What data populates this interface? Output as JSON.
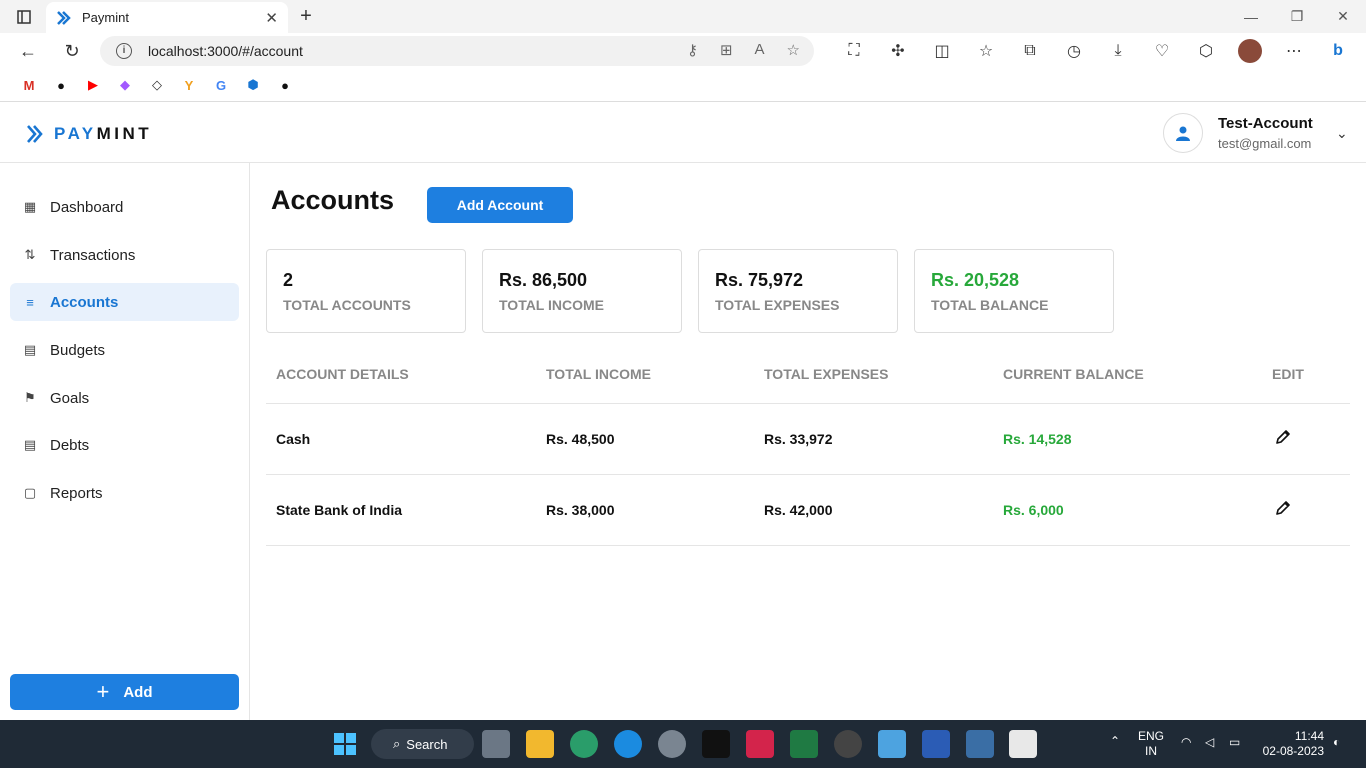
{
  "browser": {
    "tab_title": "Paymint",
    "url": "localhost:3000/#/account"
  },
  "app": {
    "logo_pay": "PAY",
    "logo_mint": "MINT",
    "user": {
      "name": "Test-Account",
      "email": "test@gmail.com"
    }
  },
  "sidebar": {
    "items": [
      {
        "label": "Dashboard",
        "icon": "grid-icon"
      },
      {
        "label": "Transactions",
        "icon": "transactions-icon"
      },
      {
        "label": "Accounts",
        "icon": "database-icon"
      },
      {
        "label": "Budgets",
        "icon": "calendar-icon"
      },
      {
        "label": "Goals",
        "icon": "goal-icon"
      },
      {
        "label": "Debts",
        "icon": "calendar-icon"
      },
      {
        "label": "Reports",
        "icon": "clipboard-icon"
      }
    ],
    "active": "Accounts",
    "add_label": "Add"
  },
  "page": {
    "title": "Accounts",
    "add_account_label": "Add Account"
  },
  "summary": [
    {
      "value": "2",
      "label": "TOTAL ACCOUNTS"
    },
    {
      "value": "Rs. 86,500",
      "label": "TOTAL INCOME"
    },
    {
      "value": "Rs. 75,972",
      "label": "TOTAL EXPENSES"
    },
    {
      "value": "Rs. 20,528",
      "label": "TOTAL BALANCE"
    }
  ],
  "table": {
    "headers": [
      "ACCOUNT DETAILS",
      "TOTAL INCOME",
      "TOTAL EXPENSES",
      "CURRENT BALANCE",
      "EDIT"
    ],
    "rows": [
      {
        "name": "Cash",
        "income": "Rs. 48,500",
        "expenses": "Rs. 33,972",
        "balance": "Rs. 14,528"
      },
      {
        "name": "State Bank of India",
        "income": "Rs. 38,000",
        "expenses": "Rs. 42,000",
        "balance": "Rs. 6,000"
      }
    ]
  },
  "taskbar": {
    "search_label": "Search",
    "lang_1": "ENG",
    "lang_2": "IN",
    "time": "11:44",
    "date": "02-08-2023"
  },
  "colors": {
    "brand": "#1976d2",
    "button": "#1e7fe0",
    "positive": "#27a83a"
  }
}
